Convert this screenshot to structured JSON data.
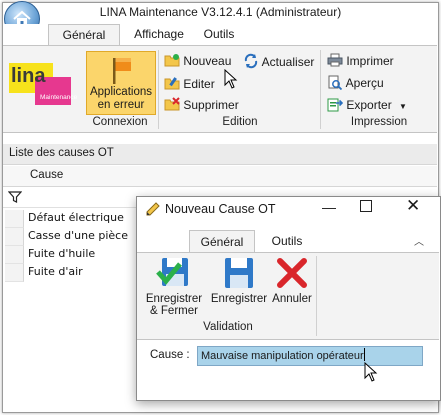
{
  "window": {
    "title": "LINA Maintenance  V3.12.4.1 (Administrateur)"
  },
  "tabs": [
    {
      "label": "Général"
    },
    {
      "label": "Affichage"
    },
    {
      "label": "Outils"
    }
  ],
  "ribbon": {
    "connexion": {
      "logo_text": "lina",
      "logo_subtext": "Maintenance",
      "app_button": "Applications en erreur",
      "app_button_line1": "Applications",
      "app_button_line2": "en erreur",
      "group_label": "Connexion"
    },
    "edition": {
      "nouveau": "Nouveau",
      "actualiser": "Actualiser",
      "editer": "Editer",
      "supprimer": "Supprimer",
      "group_label": "Edition"
    },
    "impression": {
      "imprimer": "Imprimer",
      "apercu": "Aperçu",
      "exporter": "Exporter",
      "group_label": "Impression"
    }
  },
  "panel": {
    "title": "Liste des causes OT",
    "column_header": "Cause",
    "rows": [
      "Défaut électrique",
      "Casse d'une pièce",
      "Fuite d'huile",
      "Fuite d'air"
    ]
  },
  "dialog": {
    "title": "Nouveau Cause OT",
    "tabs": [
      {
        "label": "Général"
      },
      {
        "label": "Outils"
      }
    ],
    "buttons": {
      "enregistrer_fermer_line1": "Enregistrer",
      "enregistrer_fermer_line2": "& Fermer",
      "enregistrer": "Enregistrer",
      "annuler": "Annuler"
    },
    "group_label": "Validation",
    "cause_label": "Cause :",
    "cause_value": "Mauvaise manipulation opérateur"
  },
  "colors": {
    "accent_button": "#fbd56b",
    "input_highlight": "#a9d3ea",
    "logo_yellow": "#f7e21b",
    "logo_magenta": "#e6388f"
  }
}
